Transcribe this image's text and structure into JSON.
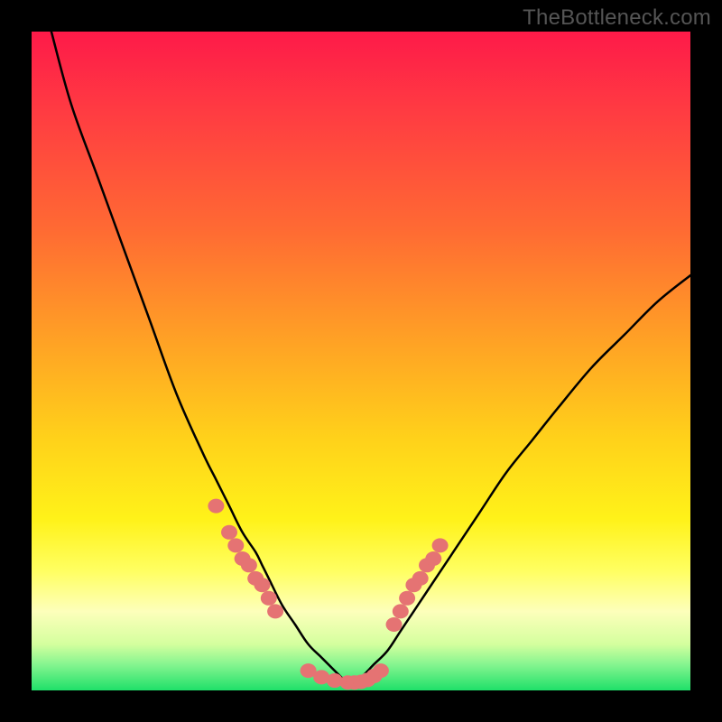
{
  "watermark": "TheBottleneck.com",
  "colors": {
    "background": "#000000",
    "curve_stroke": "#000000",
    "marker_fill": "#e57373",
    "marker_stroke": "#cc5f5f"
  },
  "chart_data": {
    "type": "line",
    "title": "",
    "xlabel": "",
    "ylabel": "",
    "xlim": [
      0,
      100
    ],
    "ylim": [
      0,
      100
    ],
    "grid": false,
    "legend": false,
    "series": [
      {
        "name": "left-curve",
        "x": [
          3,
          6,
          10,
          14,
          18,
          22,
          26,
          28,
          30,
          32,
          34,
          35,
          36,
          38,
          40,
          42,
          44,
          46,
          47,
          48
        ],
        "values": [
          100,
          89,
          78,
          67,
          56,
          45,
          36,
          32,
          28,
          24,
          21,
          19,
          17,
          13,
          10,
          7,
          5,
          3,
          2,
          1
        ]
      },
      {
        "name": "right-curve",
        "x": [
          48,
          50,
          52,
          54,
          56,
          58,
          60,
          64,
          68,
          72,
          76,
          80,
          85,
          90,
          95,
          100
        ],
        "values": [
          1,
          2,
          4,
          6,
          9,
          12,
          15,
          21,
          27,
          33,
          38,
          43,
          49,
          54,
          59,
          63
        ]
      },
      {
        "name": "markers-left-cluster",
        "x": [
          28,
          30,
          31,
          32,
          33,
          34,
          35,
          36,
          37
        ],
        "values": [
          28,
          24,
          22,
          20,
          19,
          17,
          16,
          14,
          12
        ]
      },
      {
        "name": "markers-trough",
        "x": [
          42,
          44,
          46,
          48,
          49,
          50,
          51,
          52,
          53
        ],
        "values": [
          3,
          2,
          1.5,
          1.2,
          1.2,
          1.3,
          1.6,
          2.2,
          3
        ]
      },
      {
        "name": "markers-right-cluster",
        "x": [
          55,
          56,
          57,
          58,
          59,
          60,
          61,
          62
        ],
        "values": [
          10,
          12,
          14,
          16,
          17,
          19,
          20,
          22
        ]
      }
    ]
  }
}
